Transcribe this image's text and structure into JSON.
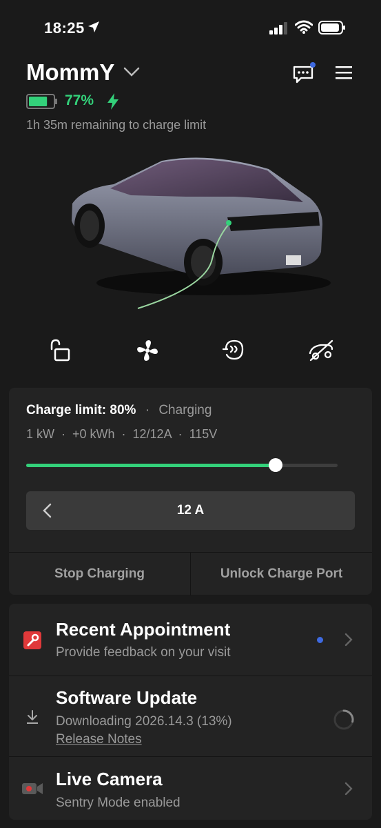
{
  "status_bar": {
    "time": "18:25"
  },
  "header": {
    "car_name": "MommY",
    "battery_percent": "77%",
    "battery_level": 0.77,
    "charge_remaining": "1h 35m remaining to charge limit"
  },
  "quick_controls": [
    "lock-icon",
    "fan-icon",
    "climate-icon",
    "charge-port-icon"
  ],
  "charging": {
    "limit_label": "Charge limit: 80%",
    "separator": "·",
    "state": "Charging",
    "stats": "1 kW  ·  +0 kWh  ·  12/12A  ·  115V",
    "limit_level": 0.8,
    "amps": "12 A",
    "stop_button": "Stop Charging",
    "unlock_button": "Unlock Charge Port"
  },
  "list": {
    "appointment": {
      "title": "Recent Appointment",
      "subtitle": "Provide feedback on your visit"
    },
    "software": {
      "title": "Software Update",
      "subtitle": "Downloading 2026.14.3 (13%)",
      "link": "Release Notes",
      "progress": 0.13
    },
    "camera": {
      "title": "Live Camera",
      "subtitle": "Sentry Mode enabled"
    }
  },
  "colors": {
    "accent_green": "#33d17a",
    "notification_blue": "#3e6ae1",
    "service_red": "#e0393a"
  }
}
